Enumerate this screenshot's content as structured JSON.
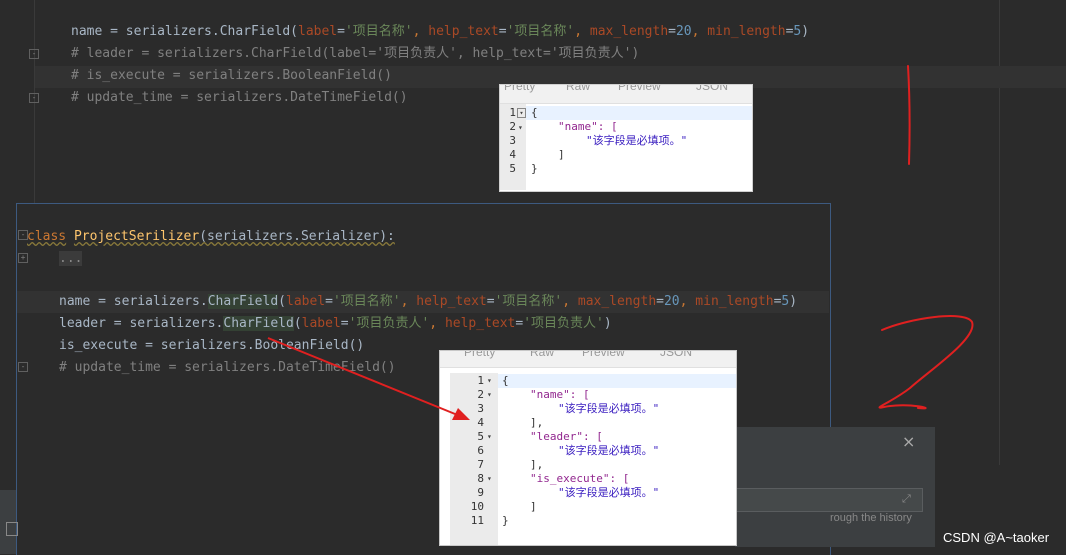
{
  "top_code": {
    "line1": {
      "lhs": "name = serializers.",
      "fn": "CharField",
      "open": "(",
      "p1": "label",
      "eq1": "=",
      "v1": "'项目名称'",
      "c1": ", ",
      "p2": "help_text",
      "eq2": "=",
      "v2": "'项目名称'",
      "c2": ", ",
      "p3": "max_length",
      "eq3": "=",
      "v3": "20",
      "c3": ", ",
      "p4": "min_length",
      "eq4": "=",
      "v4": "5",
      "close": ")"
    },
    "line2": "# leader = serializers.CharField(label='项目负责人', help_text='项目负责人')",
    "line3": "# is_execute = serializers.BooleanField()",
    "line4": "# update_time = serializers.DateTimeField()"
  },
  "json_panel_1": {
    "tabs": [
      "Pretty",
      "Raw",
      "Preview",
      "JSON"
    ],
    "lines": [
      "1",
      "2",
      "3",
      "4",
      "5"
    ],
    "content": [
      "{",
      "\"name\": [",
      "\"该字段是必填项。\"",
      "]",
      "}"
    ]
  },
  "bottom_code": {
    "class_kw": "class",
    "class_name": "ProjectSerilizer",
    "class_rest": "(serializers.Serializer):",
    "ellipsis": "...",
    "line_name": {
      "lhs": "name = serializers.",
      "fn": "CharField",
      "open": "(",
      "p1": "label",
      "v1": "'项目名称'",
      "p2": "help_text",
      "v2": "'项目名称'",
      "p3": "max_length",
      "v3": "20",
      "p4": "min_length",
      "v4": "5",
      "close": ")"
    },
    "line_leader": {
      "lhs": "leader = serializers.",
      "fn": "CharField",
      "open": "(",
      "p1": "label",
      "v1": "'项目负责人'",
      "p2": "help_text",
      "v2": "'项目负责人'",
      "close": ")"
    },
    "line_execute": "is_execute = serializers.BooleanField()",
    "line_update": "# update_time = serializers.DateTimeField()"
  },
  "json_panel_2": {
    "tabs": [
      "Pretty",
      "Raw",
      "Preview",
      "JSON"
    ],
    "lines": [
      "1",
      "2",
      "3",
      "4",
      "5",
      "6",
      "7",
      "8",
      "9",
      "10",
      "11"
    ],
    "content": [
      "{",
      "\"name\": [",
      "\"该字段是必填项。\"",
      "],",
      "\"leader\": [",
      "\"该字段是必填项。\"",
      "],",
      "\"is_execute\": [",
      "\"该字段是必填项。\"",
      "]",
      "}"
    ]
  },
  "dialog": {
    "close": "×",
    "history_text": "rough the history"
  },
  "annotations": {
    "mark1": "1",
    "mark2": "2"
  },
  "watermark": "CSDN @A~taoker",
  "colors": {
    "editor_bg": "#2b2b2b",
    "keyword": "#cc7832",
    "string": "#6a8759",
    "number": "#6897bb",
    "param": "#aa4926",
    "comment": "#808080",
    "annotation_red": "#e02020"
  }
}
